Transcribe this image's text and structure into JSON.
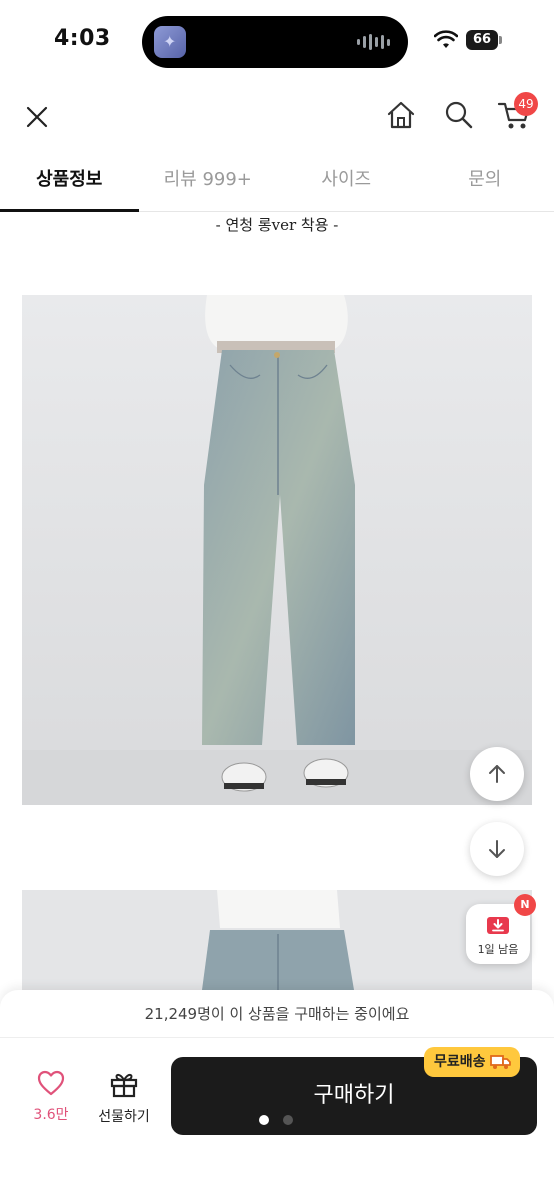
{
  "status_bar": {
    "time": "4:03",
    "battery": "66"
  },
  "header": {
    "cart_count": "49"
  },
  "tabs": [
    {
      "label": "상품정보",
      "active": true
    },
    {
      "label": "리뷰 999+",
      "active": false
    },
    {
      "label": "사이즈",
      "active": false
    },
    {
      "label": "문의",
      "active": false
    }
  ],
  "content": {
    "caption": "- 연청 롱ver 착용 -"
  },
  "floating": {
    "coupon_label": "1일 남음",
    "coupon_badge": "N"
  },
  "bottom_bar": {
    "buyer_banner": "21,249명이 이 상품을 구매하는 중이에요",
    "like_count": "3.6만",
    "gift_label": "선물하기",
    "buy_label": "구매하기",
    "free_shipping_label": "무료배송",
    "page_dots": {
      "count": 2,
      "active_index": 0
    }
  },
  "colors": {
    "accent_red": "#f04747",
    "like_pink": "#e0527a",
    "free_ship_yellow": "#ffc83d",
    "buy_button": "#1b1b1b"
  },
  "icons": [
    "close-icon",
    "home-icon",
    "search-icon",
    "cart-icon",
    "arrow-up-icon",
    "arrow-down-icon",
    "coupon-download-icon",
    "heart-icon",
    "gift-icon",
    "truck-icon"
  ]
}
